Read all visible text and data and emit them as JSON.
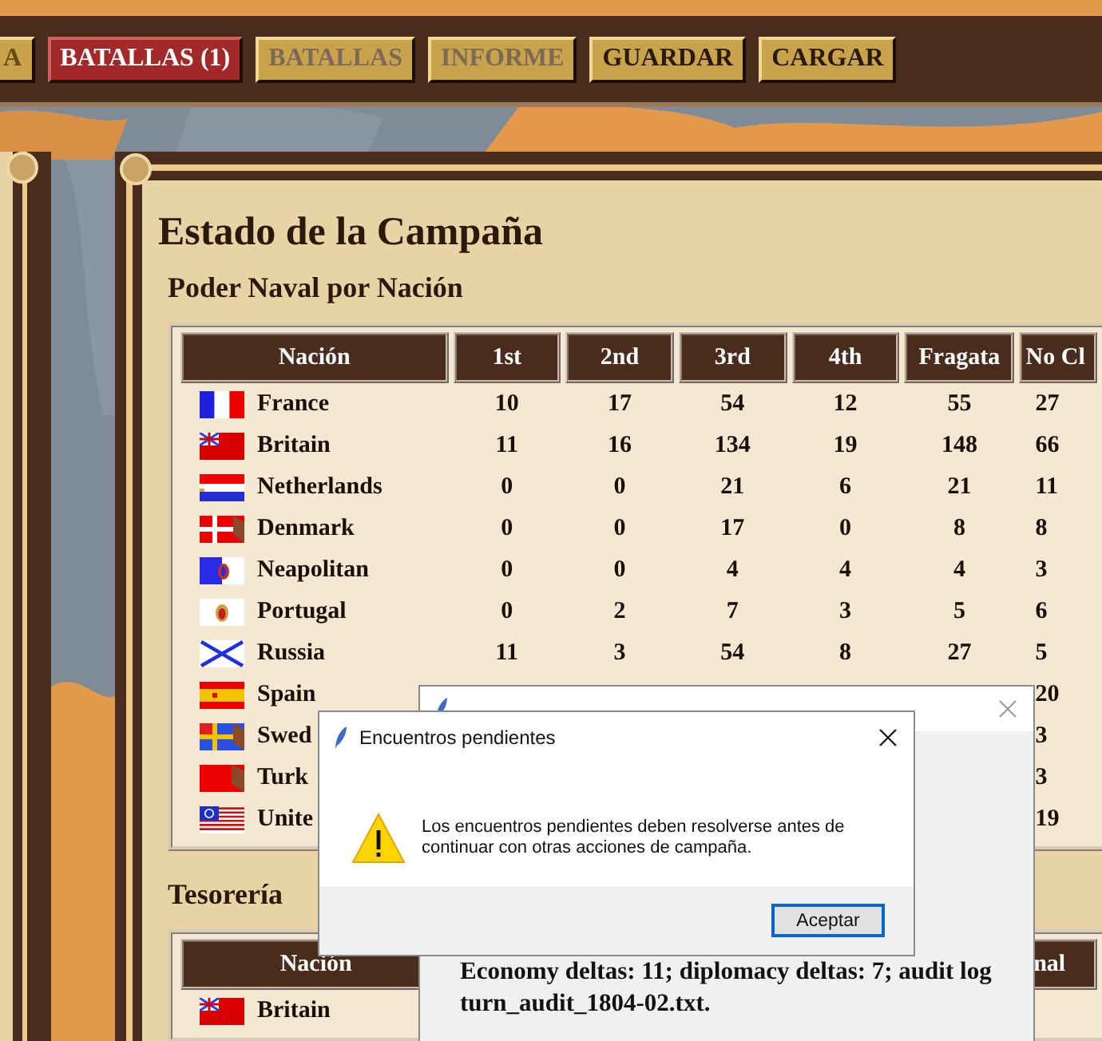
{
  "toolbar": {
    "buttons": [
      {
        "label": "A",
        "disabled": false,
        "highlighted": false
      },
      {
        "label": "BATALLAS (1)",
        "disabled": false,
        "highlighted": true
      },
      {
        "label": "BATALLAS",
        "disabled": true,
        "highlighted": false
      },
      {
        "label": "INFORME",
        "disabled": true,
        "highlighted": false
      },
      {
        "label": "GUARDAR",
        "disabled": false,
        "highlighted": false
      },
      {
        "label": "CARGAR",
        "disabled": false,
        "highlighted": false
      }
    ]
  },
  "panel": {
    "title": "Estado de la Campaña",
    "naval": {
      "heading": "Poder Naval por Nación",
      "columns": [
        "Nación",
        "1st",
        "2nd",
        "3rd",
        "4th",
        "Fragata",
        "No Cl"
      ],
      "rows": [
        {
          "nation": "France",
          "values": [
            "10",
            "17",
            "54",
            "12",
            "55",
            "27"
          ]
        },
        {
          "nation": "Britain",
          "values": [
            "11",
            "16",
            "134",
            "19",
            "148",
            "66"
          ]
        },
        {
          "nation": "Netherlands",
          "values": [
            "0",
            "0",
            "21",
            "6",
            "21",
            "11"
          ]
        },
        {
          "nation": "Denmark",
          "values": [
            "0",
            "0",
            "17",
            "0",
            "8",
            "8"
          ]
        },
        {
          "nation": "Neapolitan",
          "values": [
            "0",
            "0",
            "4",
            "4",
            "4",
            "3"
          ]
        },
        {
          "nation": "Portugal",
          "values": [
            "0",
            "2",
            "7",
            "3",
            "5",
            "6"
          ]
        },
        {
          "nation": "Russia",
          "values": [
            "11",
            "3",
            "54",
            "8",
            "27",
            "5"
          ]
        },
        {
          "nation": "Spain",
          "last": "20"
        },
        {
          "nation": "Swed",
          "last": "3"
        },
        {
          "nation": "Turk",
          "last": "3"
        },
        {
          "nation": "Unite",
          "last": "19"
        }
      ]
    },
    "treasury": {
      "heading": "Tesorería",
      "columns": [
        "Nación",
        "nal"
      ],
      "rows": [
        {
          "nation": "Britain"
        }
      ]
    }
  },
  "dialogs": [
    {
      "title": "Encuentros pendientes",
      "active": true,
      "message": "Los encuentros pendientes deben resolverse antes de continuar con otras acciones de campaña.",
      "button": "Aceptar"
    },
    {
      "active": false,
      "message": "Economy deltas: 11; diplomacy deltas: 7; audit log turn_audit_1804-02.txt."
    }
  ]
}
